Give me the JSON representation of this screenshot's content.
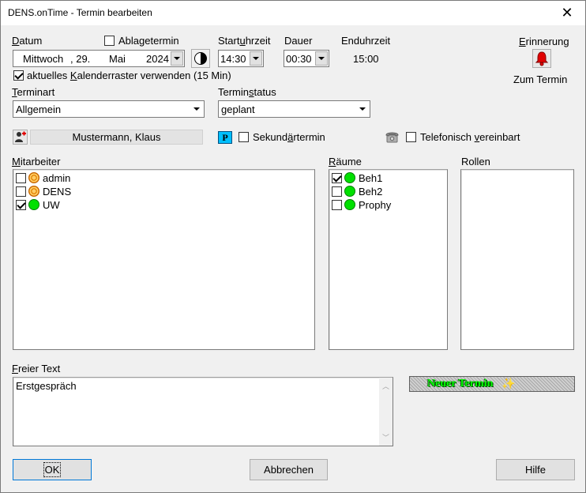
{
  "window": {
    "title": "DENS.onTime - Termin bearbeiten"
  },
  "date": {
    "label": "Datum",
    "weekday": "Mittwoch",
    "day": ", 29.",
    "month": "Mai",
    "year": "2024",
    "archive_label": "Ablagetermin",
    "archive_checked": false
  },
  "start": {
    "label": "Startuhrzeit",
    "value": "14:30"
  },
  "duration": {
    "label": "Dauer",
    "value": "00:30"
  },
  "end": {
    "label": "Enduhrzeit",
    "value": "15:00"
  },
  "reminder": {
    "label": "Erinnerung",
    "link": "Zum Termin"
  },
  "grid_option": {
    "label": "aktuelles Kalenderraster verwenden (15 Min)",
    "checked": true
  },
  "type": {
    "label": "Terminart",
    "value": "Allgemein"
  },
  "status": {
    "label": "Terminstatus",
    "value": "geplant"
  },
  "patient": {
    "name": "Mustermann, Klaus",
    "p_badge": "P"
  },
  "secondary": {
    "label": "Sekundärtermin",
    "checked": false
  },
  "phone": {
    "label": "Telefonisch vereinbart",
    "checked": false
  },
  "staff": {
    "label": "Mitarbeiter",
    "items": [
      {
        "name": "admin",
        "checked": false,
        "status": "orange"
      },
      {
        "name": "DENS",
        "checked": false,
        "status": "orange"
      },
      {
        "name": "UW",
        "checked": true,
        "status": "green"
      }
    ]
  },
  "rooms": {
    "label": "Räume",
    "items": [
      {
        "name": "Beh1",
        "checked": true,
        "status": "green"
      },
      {
        "name": "Beh2",
        "checked": false,
        "status": "green"
      },
      {
        "name": "Prophy",
        "checked": false,
        "status": "green"
      }
    ]
  },
  "roles": {
    "label": "Rollen"
  },
  "free_text": {
    "label": "Freier Text",
    "value": "Erstgespräch"
  },
  "new_badge": "Neuer Termin",
  "buttons": {
    "ok": "OK",
    "cancel": "Abbrechen",
    "help": "Hilfe"
  }
}
